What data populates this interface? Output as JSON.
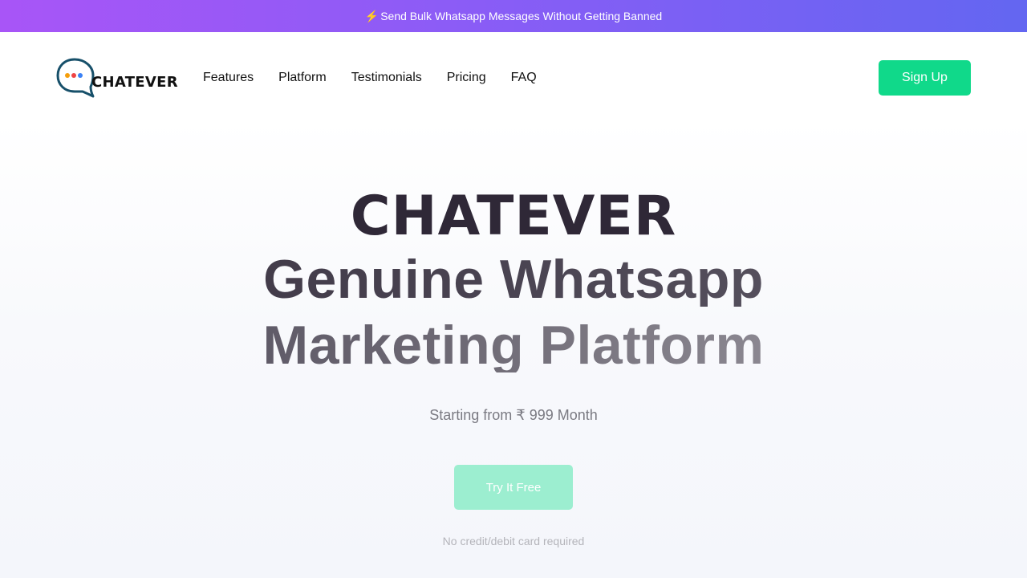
{
  "promo": {
    "icon": "lightning-bolt-icon",
    "icon_glyph": "⚡",
    "text": "Send Bulk Whatsapp Messages Without Getting Banned"
  },
  "header": {
    "logo_text": "CHATEVER",
    "logo_icon": "chat-bubble-icon",
    "nav": [
      "Features",
      "Platform",
      "Testimonials",
      "Pricing",
      "FAQ"
    ],
    "signup_label": "Sign Up"
  },
  "hero": {
    "title": "CHATEVER",
    "line1": "Genuine Whatsapp",
    "line2": "Marketing Platform",
    "subtitle": "Starting from ₹ 999 Month",
    "cta_label": "Try It Free",
    "cta_note": "No credit/debit card required"
  },
  "colors": {
    "promo_gradient_start": "#a855f7",
    "promo_gradient_end": "#6366f1",
    "accent_green": "#10d98a",
    "cta_faded_green": "#9ceed0",
    "title_dark": "#2f2837"
  }
}
